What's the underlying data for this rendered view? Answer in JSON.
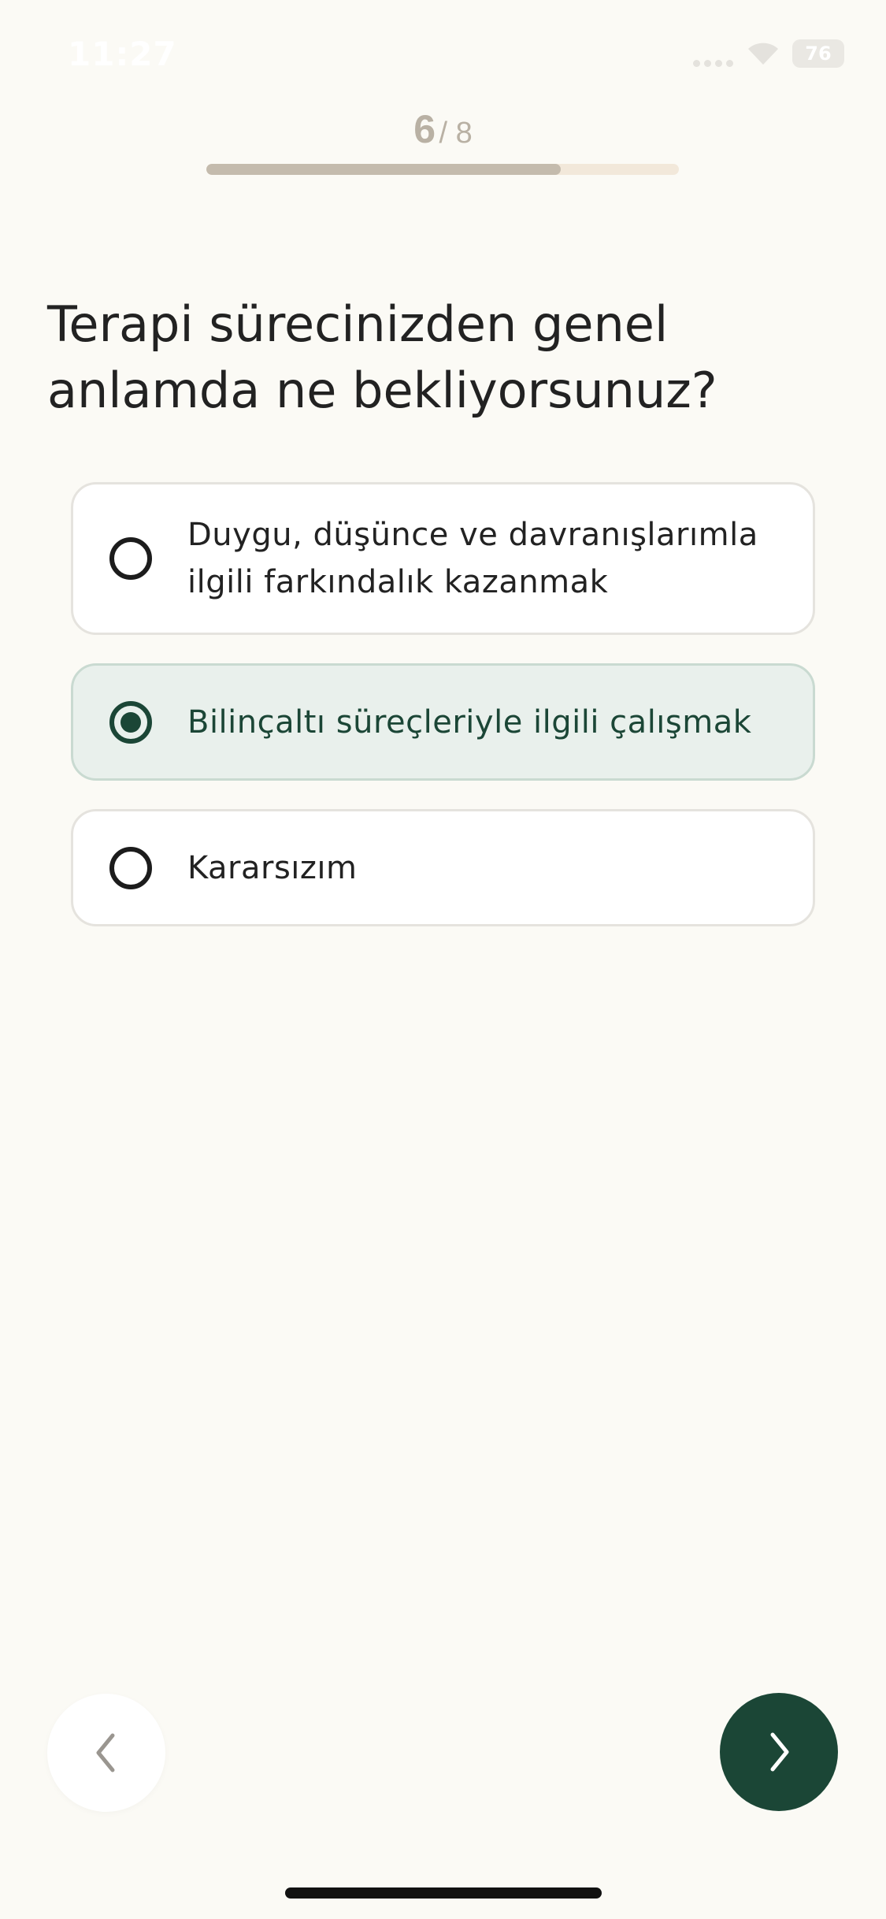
{
  "status_bar": {
    "time": "11:27",
    "battery": "76"
  },
  "progress": {
    "current": "6",
    "separator": "/ 8",
    "fraction": 0.75
  },
  "question": {
    "title": "Terapi sürecinizden genel\nanlamda ne bekliyorsunuz?"
  },
  "options": [
    {
      "label": "Duygu, düşünce ve davranışlarımla ilgili farkındalık kazanmak",
      "selected": false
    },
    {
      "label": "Bilinçaltı süreçleriyle ilgili çalışmak",
      "selected": true
    },
    {
      "label": "Kararsızım",
      "selected": false
    }
  ],
  "navigation": {
    "back_icon": "chevron-left-icon",
    "next_icon": "chevron-right-icon"
  },
  "colors": {
    "background": "#FBFAF5",
    "accent": "#1B4636",
    "selected_bg": "#E9F0EC",
    "progress_fill": "#C4BBAD",
    "progress_track": "#F2E8DA"
  }
}
